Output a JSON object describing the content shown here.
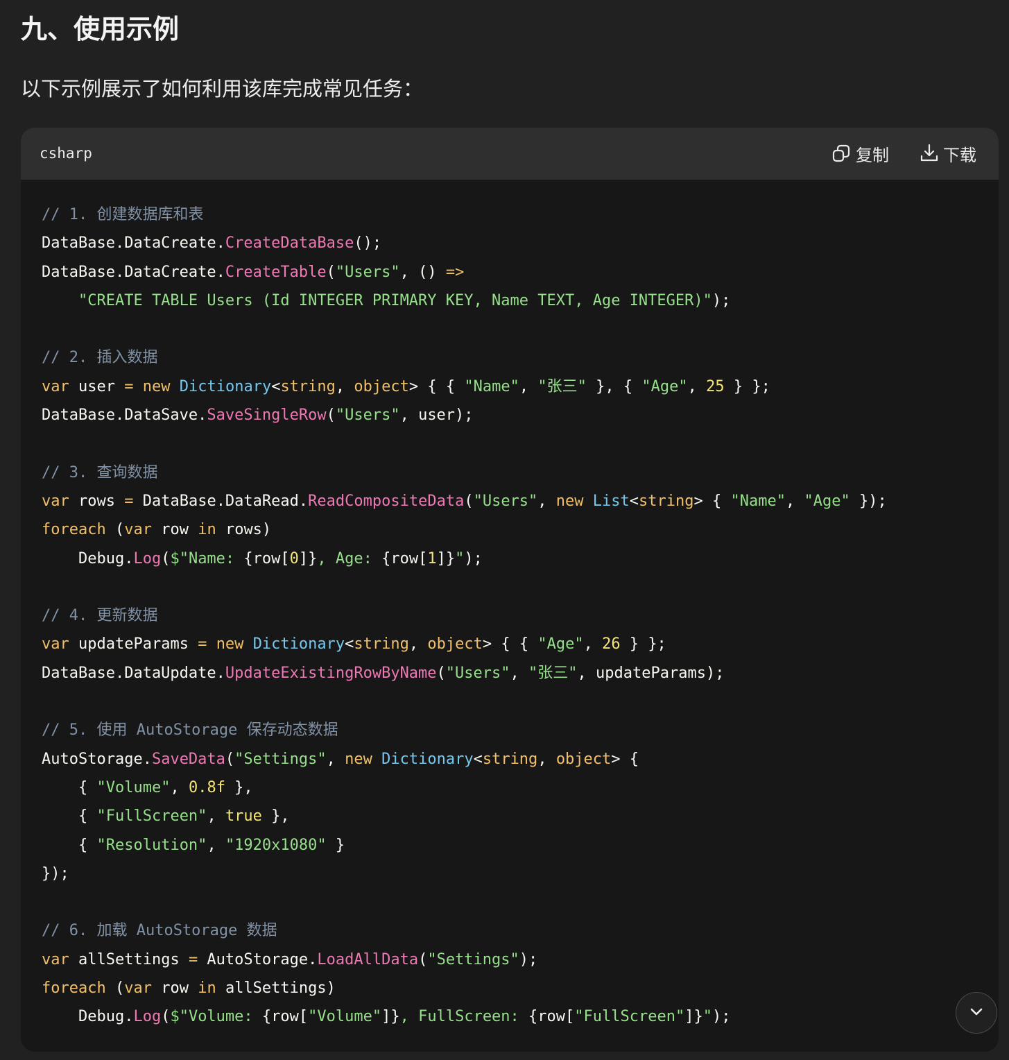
{
  "section": {
    "heading": "九、使用示例",
    "intro": "以下示例展示了如何利用该库完成常见任务："
  },
  "code_block": {
    "language": "csharp",
    "copy_label": "复制",
    "download_label": "下载",
    "lines": [
      [
        {
          "t": "// 1. 创建数据库和表",
          "c": "cm"
        }
      ],
      [
        {
          "t": "DataBase.DataCreate."
        },
        {
          "t": "CreateDataBase",
          "c": "fn"
        },
        {
          "t": "();"
        }
      ],
      [
        {
          "t": "DataBase.DataCreate."
        },
        {
          "t": "CreateTable",
          "c": "fn"
        },
        {
          "t": "("
        },
        {
          "t": "\"Users\"",
          "c": "str"
        },
        {
          "t": ", () "
        },
        {
          "t": "=>",
          "c": "op"
        }
      ],
      [
        {
          "t": "    "
        },
        {
          "t": "\"CREATE TABLE Users (Id INTEGER PRIMARY KEY, Name TEXT, Age INTEGER)\"",
          "c": "str"
        },
        {
          "t": ");"
        }
      ],
      [],
      [
        {
          "t": "// 2. 插入数据",
          "c": "cm"
        }
      ],
      [
        {
          "t": "var",
          "c": "kw"
        },
        {
          "t": " user "
        },
        {
          "t": "=",
          "c": "op"
        },
        {
          "t": " "
        },
        {
          "t": "new",
          "c": "kw"
        },
        {
          "t": " "
        },
        {
          "t": "Dictionary",
          "c": "ty"
        },
        {
          "t": "<"
        },
        {
          "t": "string",
          "c": "kw"
        },
        {
          "t": ", "
        },
        {
          "t": "object",
          "c": "kw"
        },
        {
          "t": "> { { "
        },
        {
          "t": "\"Name\"",
          "c": "str"
        },
        {
          "t": ", "
        },
        {
          "t": "\"张三\"",
          "c": "str"
        },
        {
          "t": " }, { "
        },
        {
          "t": "\"Age\"",
          "c": "str"
        },
        {
          "t": ", "
        },
        {
          "t": "25",
          "c": "num"
        },
        {
          "t": " } };"
        }
      ],
      [
        {
          "t": "DataBase.DataSave."
        },
        {
          "t": "SaveSingleRow",
          "c": "fn"
        },
        {
          "t": "("
        },
        {
          "t": "\"Users\"",
          "c": "str"
        },
        {
          "t": ", user);"
        }
      ],
      [],
      [
        {
          "t": "// 3. 查询数据",
          "c": "cm"
        }
      ],
      [
        {
          "t": "var",
          "c": "kw"
        },
        {
          "t": " rows "
        },
        {
          "t": "=",
          "c": "op"
        },
        {
          "t": " DataBase.DataRead."
        },
        {
          "t": "ReadCompositeData",
          "c": "fn"
        },
        {
          "t": "("
        },
        {
          "t": "\"Users\"",
          "c": "str"
        },
        {
          "t": ", "
        },
        {
          "t": "new",
          "c": "kw"
        },
        {
          "t": " "
        },
        {
          "t": "List",
          "c": "ty"
        },
        {
          "t": "<"
        },
        {
          "t": "string",
          "c": "kw"
        },
        {
          "t": "> { "
        },
        {
          "t": "\"Name\"",
          "c": "str"
        },
        {
          "t": ", "
        },
        {
          "t": "\"Age\"",
          "c": "str"
        },
        {
          "t": " });"
        }
      ],
      [
        {
          "t": "foreach",
          "c": "kw"
        },
        {
          "t": " ("
        },
        {
          "t": "var",
          "c": "kw"
        },
        {
          "t": " row "
        },
        {
          "t": "in",
          "c": "kw"
        },
        {
          "t": " rows)"
        }
      ],
      [
        {
          "t": "    Debug."
        },
        {
          "t": "Log",
          "c": "fn"
        },
        {
          "t": "("
        },
        {
          "t": "$\"Name: ",
          "c": "str"
        },
        {
          "t": "{row["
        },
        {
          "t": "0",
          "c": "num"
        },
        {
          "t": "]}"
        },
        {
          "t": ", Age: ",
          "c": "str"
        },
        {
          "t": "{row["
        },
        {
          "t": "1",
          "c": "num"
        },
        {
          "t": "]}"
        },
        {
          "t": "\"",
          "c": "str"
        },
        {
          "t": ");"
        }
      ],
      [],
      [
        {
          "t": "// 4. 更新数据",
          "c": "cm"
        }
      ],
      [
        {
          "t": "var",
          "c": "kw"
        },
        {
          "t": " updateParams "
        },
        {
          "t": "=",
          "c": "op"
        },
        {
          "t": " "
        },
        {
          "t": "new",
          "c": "kw"
        },
        {
          "t": " "
        },
        {
          "t": "Dictionary",
          "c": "ty"
        },
        {
          "t": "<"
        },
        {
          "t": "string",
          "c": "kw"
        },
        {
          "t": ", "
        },
        {
          "t": "object",
          "c": "kw"
        },
        {
          "t": "> { { "
        },
        {
          "t": "\"Age\"",
          "c": "str"
        },
        {
          "t": ", "
        },
        {
          "t": "26",
          "c": "num"
        },
        {
          "t": " } };"
        }
      ],
      [
        {
          "t": "DataBase.DataUpdate."
        },
        {
          "t": "UpdateExistingRowByName",
          "c": "fn"
        },
        {
          "t": "("
        },
        {
          "t": "\"Users\"",
          "c": "str"
        },
        {
          "t": ", "
        },
        {
          "t": "\"张三\"",
          "c": "str"
        },
        {
          "t": ", updateParams);"
        }
      ],
      [],
      [
        {
          "t": "// 5. 使用 AutoStorage 保存动态数据",
          "c": "cm"
        }
      ],
      [
        {
          "t": "AutoStorage."
        },
        {
          "t": "SaveData",
          "c": "fn"
        },
        {
          "t": "("
        },
        {
          "t": "\"Settings\"",
          "c": "str"
        },
        {
          "t": ", "
        },
        {
          "t": "new",
          "c": "kw"
        },
        {
          "t": " "
        },
        {
          "t": "Dictionary",
          "c": "ty"
        },
        {
          "t": "<"
        },
        {
          "t": "string",
          "c": "kw"
        },
        {
          "t": ", "
        },
        {
          "t": "object",
          "c": "kw"
        },
        {
          "t": "> {"
        }
      ],
      [
        {
          "t": "    { "
        },
        {
          "t": "\"Volume\"",
          "c": "str"
        },
        {
          "t": ", "
        },
        {
          "t": "0.8f",
          "c": "num"
        },
        {
          "t": " },"
        }
      ],
      [
        {
          "t": "    { "
        },
        {
          "t": "\"FullScreen\"",
          "c": "str"
        },
        {
          "t": ", "
        },
        {
          "t": "true",
          "c": "num"
        },
        {
          "t": " },"
        }
      ],
      [
        {
          "t": "    { "
        },
        {
          "t": "\"Resolution\"",
          "c": "str"
        },
        {
          "t": ", "
        },
        {
          "t": "\"1920x1080\"",
          "c": "str"
        },
        {
          "t": " }"
        }
      ],
      [
        {
          "t": "});"
        }
      ],
      [],
      [
        {
          "t": "// 6. 加载 AutoStorage 数据",
          "c": "cm"
        }
      ],
      [
        {
          "t": "var",
          "c": "kw"
        },
        {
          "t": " allSettings "
        },
        {
          "t": "=",
          "c": "op"
        },
        {
          "t": " AutoStorage."
        },
        {
          "t": "LoadAllData",
          "c": "fn"
        },
        {
          "t": "("
        },
        {
          "t": "\"Settings\"",
          "c": "str"
        },
        {
          "t": ");"
        }
      ],
      [
        {
          "t": "foreach",
          "c": "kw"
        },
        {
          "t": " ("
        },
        {
          "t": "var",
          "c": "kw"
        },
        {
          "t": " row "
        },
        {
          "t": "in",
          "c": "kw"
        },
        {
          "t": " allSettings)"
        }
      ],
      [
        {
          "t": "    Debug."
        },
        {
          "t": "Log",
          "c": "fn"
        },
        {
          "t": "("
        },
        {
          "t": "$\"Volume: ",
          "c": "str"
        },
        {
          "t": "{row["
        },
        {
          "t": "\"Volume\"",
          "c": "str"
        },
        {
          "t": "]}"
        },
        {
          "t": ", FullScreen: ",
          "c": "str"
        },
        {
          "t": "{row["
        },
        {
          "t": "\"FullScreen\"",
          "c": "str"
        },
        {
          "t": "]}"
        },
        {
          "t": "\"",
          "c": "str"
        },
        {
          "t": ");"
        }
      ]
    ]
  },
  "icons": {
    "copy": "copy-icon",
    "download": "download-icon",
    "scroll": "chevron-down-icon"
  },
  "colors": {
    "page_bg": "#212121",
    "code_bg": "#171717",
    "header_bg": "#2f2f2f",
    "comment": "#8292a6",
    "method": "#ee79b4",
    "string": "#97e08b",
    "keyword": "#f3c06a",
    "type": "#76c8ef",
    "number": "#f3e577"
  }
}
